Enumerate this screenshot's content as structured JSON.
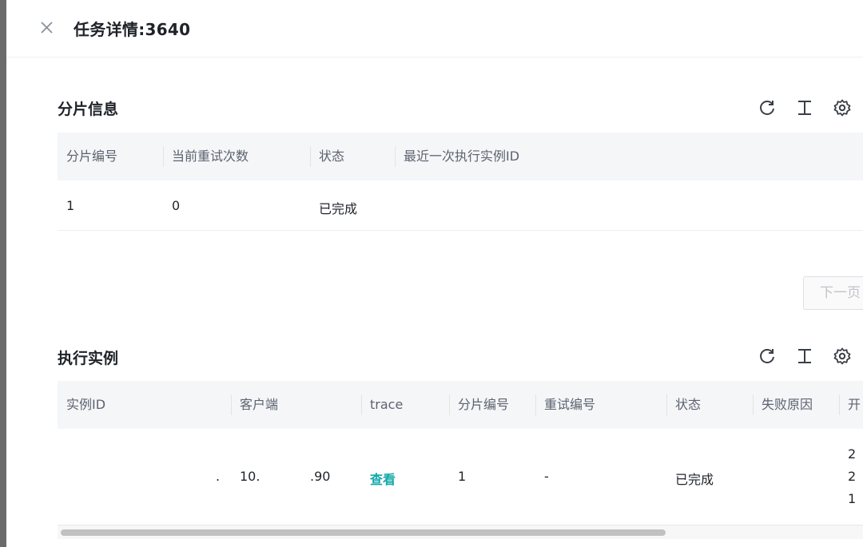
{
  "drawer": {
    "title": "任务详情:3640"
  },
  "shard_section": {
    "title": "分片信息",
    "columns": [
      "分片编号",
      "当前重试次数",
      "状态",
      "最近一次执行实例ID"
    ],
    "rows": [
      {
        "shard_no": "1",
        "retry_count": "0",
        "status": "已完成",
        "last_instance_id": ""
      }
    ],
    "next_page_label": "下一页"
  },
  "instance_section": {
    "title": "执行实例",
    "columns": [
      "实例ID",
      "客户端",
      "trace",
      "分片编号",
      "重试编号",
      "状态",
      "失败原因",
      "开"
    ],
    "rows": [
      {
        "instance_id": ".",
        "client_a": "10.",
        "client_b": ".90",
        "trace_link": "查看",
        "shard_no": "1",
        "retry_no": "-",
        "status": "已完成",
        "fail_reason": "",
        "start_l1": "2",
        "start_l2": "2",
        "start_l3": "1"
      }
    ]
  },
  "icons": [
    "close-icon",
    "refresh-icon",
    "column-height-icon",
    "settings-icon"
  ],
  "colors": {
    "accent": "#13a8a8",
    "header_bg": "#f5f6f8",
    "strip": "#6b6b6b"
  }
}
